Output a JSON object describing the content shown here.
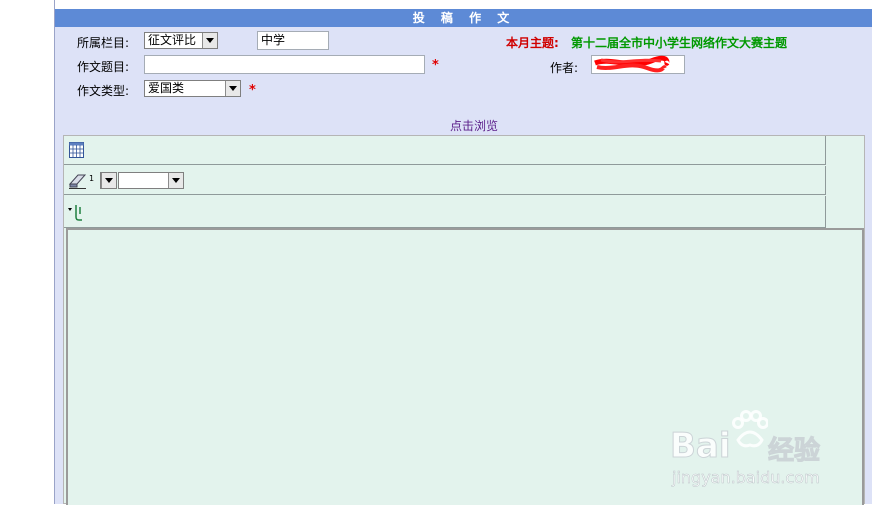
{
  "form": {
    "title": "投 稿 作 文",
    "column_label": "所属栏目:",
    "column_select": "征文评比",
    "level_input": "中学",
    "theme_label": "本月主题:",
    "theme_value": "第十二届全市中小学生网络作文大赛主题",
    "title_label": "作文题目:",
    "title_input": "",
    "required_mark": "*",
    "author_label": "作者:",
    "type_label": "作文类型:",
    "type_select": "爱国类",
    "preview_link": "点击浏览"
  },
  "editor": {
    "size_select_prefix": "1",
    "icons": [
      "table-icon",
      "eraser-icon",
      "paste-icon"
    ]
  },
  "watermark": {
    "brand": "Bai",
    "brand2": "经验",
    "url": "jingyan.baidu.com"
  },
  "colors": {
    "title_bar": "#5d8ad6",
    "form_bg": "#dde2f7",
    "editor_bg": "#e3f3ed",
    "theme_label": "#d00000",
    "theme_value": "#009900",
    "link": "#5b1e8a"
  }
}
